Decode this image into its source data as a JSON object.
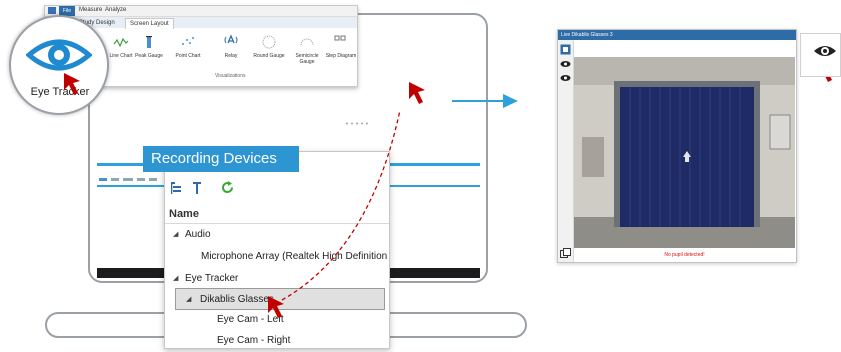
{
  "ribbon": {
    "top_menu": [
      "Measure",
      "Analyze"
    ],
    "file_tab": "File",
    "tabs": [
      "Study Design",
      "Screen Layout"
    ],
    "tools": [
      {
        "label": "Line Chart",
        "icon": "line-chart-icon"
      },
      {
        "label": "Peak Gauge",
        "icon": "peak-gauge-icon"
      },
      {
        "label": "Point Chart",
        "icon": "point-chart-icon"
      },
      {
        "label": "Relay",
        "icon": "relay-icon"
      },
      {
        "label": "Round Gauge",
        "icon": "round-gauge-icon"
      },
      {
        "label": "Semicircle Gauge",
        "icon": "semicircle-gauge-icon"
      },
      {
        "label": "Step Diagram",
        "icon": "step-diagram-icon"
      }
    ],
    "group_label": "Visualizations"
  },
  "eye_tracker_button": {
    "label": "Eye Tracker",
    "icon": "eye-icon",
    "color": "#1f8ad0"
  },
  "recording_devices": {
    "title": "Recording Devices",
    "toolbar_icons": [
      "device-list-icon",
      "pin-icon",
      "refresh-icon"
    ],
    "column_header": "Name",
    "tree": [
      {
        "label": "Audio",
        "level": 0,
        "expanded": true,
        "selected": false
      },
      {
        "label": "Microphone Array (Realtek High Definition",
        "level": 1,
        "expanded": false,
        "selected": false
      },
      {
        "label": "Eye Tracker",
        "level": 0,
        "expanded": true,
        "selected": false
      },
      {
        "label": "Dikablis Glasses",
        "level": 1,
        "expanded": true,
        "selected": true
      },
      {
        "label": "Eye Cam - Left",
        "level": 2,
        "expanded": false,
        "selected": false
      },
      {
        "label": "Eye Cam - Right",
        "level": 2,
        "expanded": false,
        "selected": false
      }
    ]
  },
  "live_window": {
    "title": "Live Dikablis Glasses 3",
    "status": "No pupil detected!",
    "side_icons": [
      "video-icon",
      "eye-icon",
      "eye-icon"
    ],
    "bottom_icon": "copy-icon"
  },
  "colors": {
    "accent": "#2e95d3",
    "cursor": "#c00000",
    "arrow": "#2ea1dc"
  }
}
